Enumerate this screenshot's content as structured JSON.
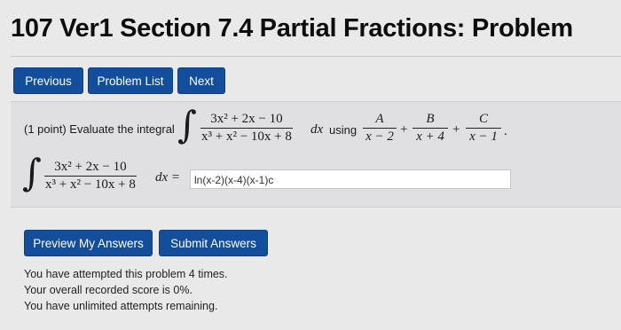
{
  "header": {
    "title": "107 Ver1 Section 7.4 Partial Fractions: Problem"
  },
  "nav": {
    "previous": "Previous",
    "problem_list": "Problem List",
    "next": "Next"
  },
  "problem": {
    "prompt": "(1 point) Evaluate the integral",
    "integrand_num": "3x² + 2x − 10",
    "integrand_den": "x³ + x² − 10x + 8",
    "dx": "dx",
    "using": "using",
    "terms": [
      {
        "num": "A",
        "den": "x − 2"
      },
      {
        "num": "B",
        "den": "x + 4"
      },
      {
        "num": "C",
        "den": "x − 1"
      }
    ],
    "plus": "+",
    "period": ".",
    "integral_sign": "∫",
    "dx_equals": "dx ="
  },
  "answer": {
    "value": "ln(x-2)(x-4)(x-1)c"
  },
  "actions": {
    "preview": "Preview My Answers",
    "submit": "Submit Answers"
  },
  "status": {
    "attempts": "You have attempted this problem 4 times.",
    "score": "Your overall recorded score is 0%.",
    "remaining": "You have unlimited attempts remaining."
  }
}
